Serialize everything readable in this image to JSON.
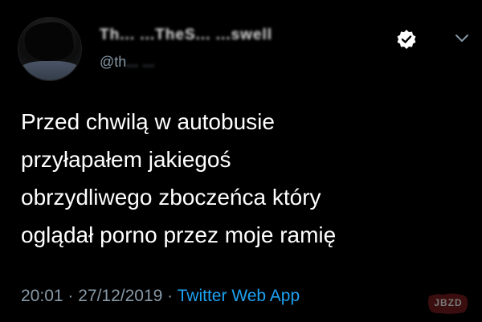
{
  "tweet": {
    "display_name": "Th... ...TheS... ...swell",
    "handle_prefix": "@th",
    "handle_redacted": "... ...",
    "lines": [
      "Przed chwilą w autobusie",
      "przyłapałem jakiegoś",
      "obrzydliwego zboczeńca który",
      "oglądał porno przez moje ramię"
    ],
    "time": "20:01",
    "date": "27/12/2019",
    "separator": " · ",
    "source": "Twitter Web App"
  },
  "icons": {
    "verified": "verified-badge-icon",
    "caret": "chevron-down-icon"
  },
  "watermark": {
    "text": "JBZD"
  },
  "colors": {
    "background": "#000000",
    "text": "#ffffff",
    "muted": "#8899a6",
    "link": "#1da1f2"
  }
}
